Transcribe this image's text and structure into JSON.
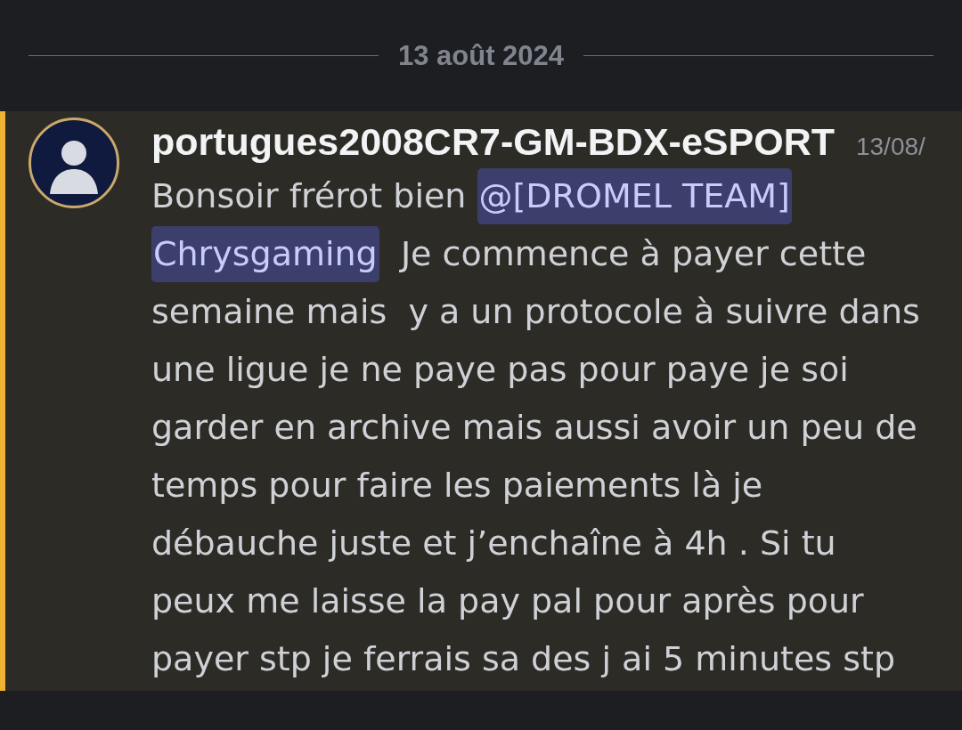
{
  "date_divider": {
    "label": "13 août 2024"
  },
  "message": {
    "mentioned": true,
    "author": "portugues2008CR7-GM-BDX-eSPORT",
    "timestamp": "13/08/",
    "lines": [
      [
        {
          "kind": "text",
          "text": "Bonsoir frérot bien "
        },
        {
          "kind": "mention",
          "text": "@[DROMEL TEAM]"
        }
      ],
      [
        {
          "kind": "mention",
          "text": "Chrysgaming"
        },
        {
          "kind": "text",
          "text": "  Je commence à payer cette"
        }
      ],
      [
        {
          "kind": "text",
          "text": "semaine mais  y a un protocole à suivre dans"
        }
      ],
      [
        {
          "kind": "text",
          "text": "une ligue je ne paye pas pour paye je soi"
        }
      ],
      [
        {
          "kind": "text",
          "text": "garder en archive mais aussi avoir un peu de"
        }
      ],
      [
        {
          "kind": "text",
          "text": "temps pour faire les paiements là je"
        }
      ],
      [
        {
          "kind": "text",
          "text": "débauche juste et j’enchaîne à 4h . Si tu"
        }
      ],
      [
        {
          "kind": "text",
          "text": "peux me laisse la pay pal pour après pour"
        }
      ],
      [
        {
          "kind": "text",
          "text": "payer stp je ferrais sa des j ai 5 minutes stp"
        }
      ]
    ]
  }
}
